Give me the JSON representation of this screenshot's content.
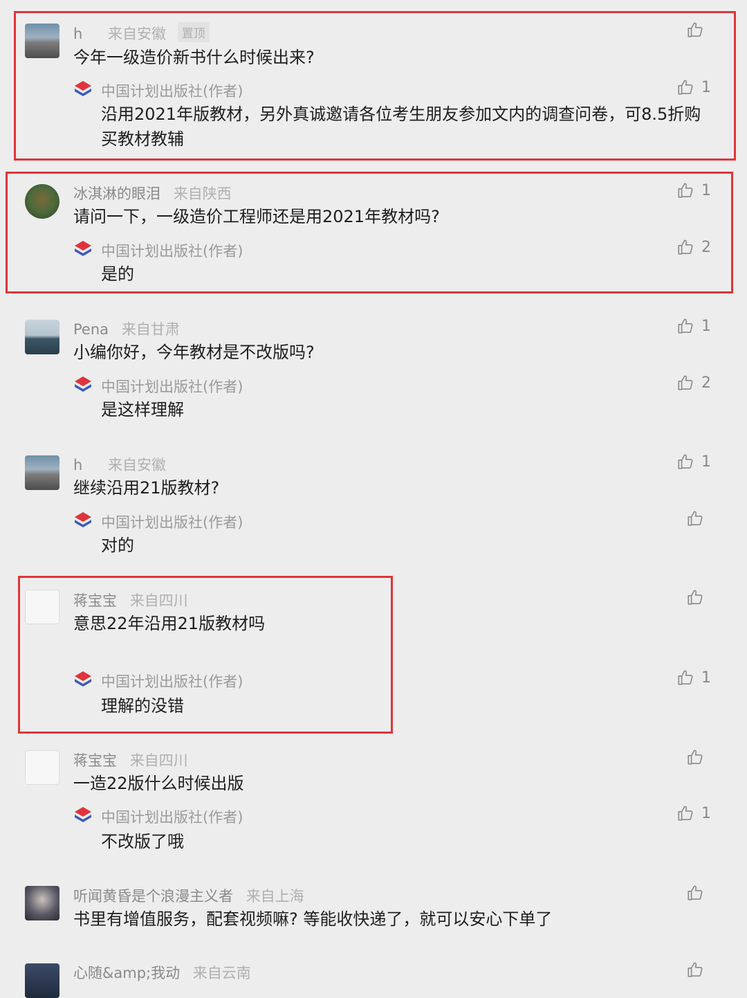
{
  "comments": [
    {
      "name": "h",
      "location": "来自安徽",
      "pinned": "置顶",
      "text": "今年一级造价新书什么时候出来?",
      "likes": "",
      "reply": {
        "name": "中国计划出版社(作者)",
        "text": "沿用2021年版教材，另外真诚邀请各位考生朋友参加文内的调查问卷，可8.5折购买教材教辅",
        "likes": "1"
      }
    },
    {
      "name": "冰淇淋的眼泪",
      "location": "来自陕西",
      "text": "请问一下，一级造价工程师还是用2021年教材吗?",
      "likes": "1",
      "reply": {
        "name": "中国计划出版社(作者)",
        "text": "是的",
        "likes": "2"
      }
    },
    {
      "name": "Pena",
      "location": "来自甘肃",
      "text": "小编你好，今年教材是不改版吗?",
      "likes": "1",
      "reply": {
        "name": "中国计划出版社(作者)",
        "text": "是这样理解",
        "likes": "2"
      }
    },
    {
      "name": "h",
      "location": "来自安徽",
      "text": "继续沿用21版教材?",
      "likes": "1",
      "reply": {
        "name": "中国计划出版社(作者)",
        "text": "对的",
        "likes": ""
      }
    },
    {
      "name": "蒋宝宝",
      "location": "来自四川",
      "text": "意思22年沿用21版教材吗",
      "likes": "",
      "reply": {
        "name": "中国计划出版社(作者)",
        "text": "理解的没错",
        "likes": "1"
      }
    },
    {
      "name": "蒋宝宝",
      "location": "来自四川",
      "text": "一造22版什么时候出版",
      "likes": "",
      "reply": {
        "name": "中国计划出版社(作者)",
        "text": "不改版了哦",
        "likes": "1"
      }
    },
    {
      "name": "听闻黄昏是个浪漫主义者",
      "location": "来自上海",
      "text": "书里有增值服务，配套视频嘛? 等能收快递了，就可以安心下单了",
      "likes": ""
    },
    {
      "name": "心随&amp;我动",
      "location": "来自云南",
      "text": "",
      "likes": ""
    }
  ],
  "colors": {
    "highlight": "#e0343b",
    "background": "#ededed"
  }
}
